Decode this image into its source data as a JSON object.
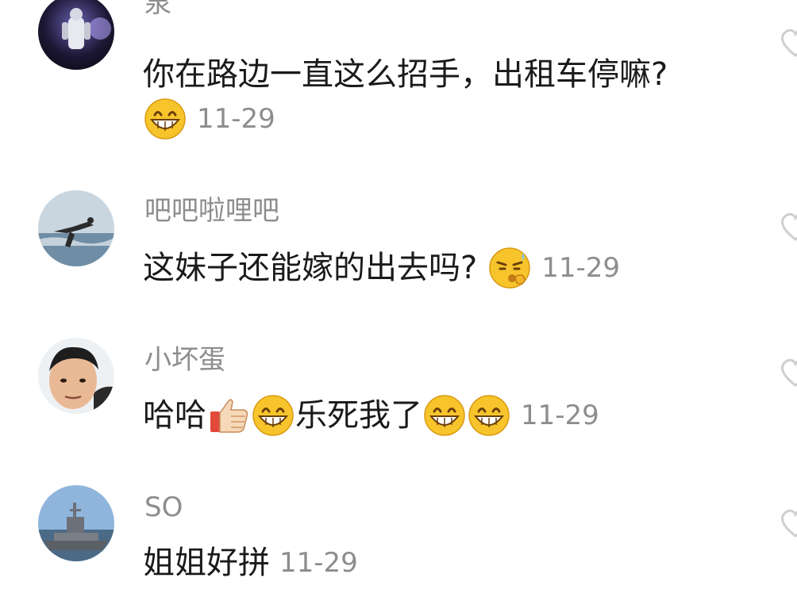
{
  "comments": [
    {
      "username": "泉",
      "text": "你在路边一直这么招手，出租车停嘛?",
      "emojis_after": [
        "grin-emoji"
      ],
      "time": "11-29"
    },
    {
      "username": "吧吧啦哩吧",
      "text": "这妹子还能嫁的出去吗?",
      "emojis_after": [
        "thinking-sweat-emoji"
      ],
      "time": "11-29"
    },
    {
      "username": "小坏蛋",
      "text_part1": "哈哈",
      "emojis_mid": [
        "thumbs-up-emoji",
        "grin-emoji"
      ],
      "text_part2": "乐死我了",
      "emojis_after": [
        "grin-emoji",
        "grin-emoji"
      ],
      "time": "11-29"
    },
    {
      "username": "SO",
      "text": "姐姐好拼",
      "time": "11-29"
    }
  ],
  "colors": {
    "text": "#1a1a1a",
    "meta": "#8d8d8d",
    "background": "#ffffff",
    "emoji_yellow": "#f7c52b"
  }
}
